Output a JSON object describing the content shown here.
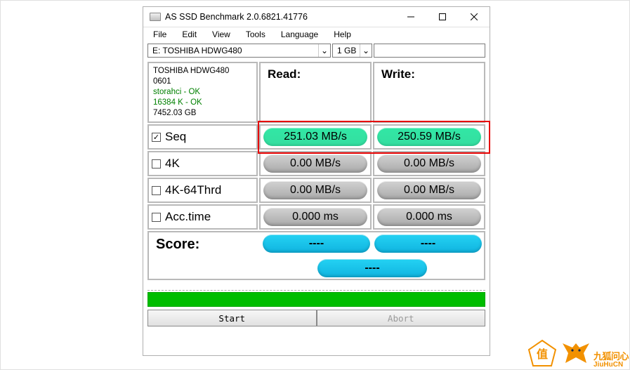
{
  "title": "AS SSD Benchmark 2.0.6821.41776",
  "menu": {
    "file": "File",
    "edit": "Edit",
    "view": "View",
    "tools": "Tools",
    "language": "Language",
    "help": "Help"
  },
  "drive_select": "E: TOSHIBA HDWG480",
  "size_select": "1 GB",
  "info": {
    "model": "TOSHIBA HDWG480",
    "fw": "0601",
    "driver": "storahci - OK",
    "align": "16384 K - OK",
    "capacity": "7452.03 GB"
  },
  "headers": {
    "read": "Read:",
    "write": "Write:"
  },
  "tests": {
    "seq": {
      "label": "Seq",
      "checked": true,
      "read": "251.03 MB/s",
      "write": "250.59 MB/s"
    },
    "k4": {
      "label": "4K",
      "checked": false,
      "read": "0.00 MB/s",
      "write": "0.00 MB/s"
    },
    "k464": {
      "label": "4K-64Thrd",
      "checked": false,
      "read": "0.00 MB/s",
      "write": "0.00 MB/s"
    },
    "acc": {
      "label": "Acc.time",
      "checked": false,
      "read": "0.000 ms",
      "write": "0.000 ms"
    }
  },
  "score": {
    "label": "Score:",
    "read": "----",
    "write": "----",
    "total": "----"
  },
  "buttons": {
    "start": "Start",
    "abort": "Abort"
  },
  "watermark": {
    "brand": "九狐问心",
    "sub": "JiuHuCN",
    "zhi": "值"
  }
}
